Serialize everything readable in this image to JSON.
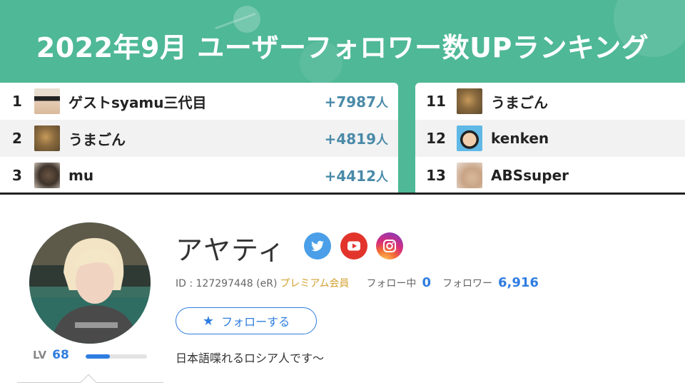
{
  "banner": {
    "title": "2022年9月 ユーザーフォロワー数UPランキング",
    "accent": "#4fb896"
  },
  "ranking": {
    "left": [
      {
        "rank": "1",
        "name": "ゲストsyamu三代目",
        "delta": "+7987",
        "unit": "人"
      },
      {
        "rank": "2",
        "name": "うまごん",
        "delta": "+4819",
        "unit": "人"
      },
      {
        "rank": "3",
        "name": "mu",
        "delta": "+4412",
        "unit": "人"
      }
    ],
    "right": [
      {
        "rank": "11",
        "name": "うまごん"
      },
      {
        "rank": "12",
        "name": "kenken"
      },
      {
        "rank": "13",
        "name": "ABSsuper"
      }
    ]
  },
  "profile": {
    "name": "アヤティ",
    "id_text": "ID : 127297448 (eR)",
    "premium": "プレミアム会員",
    "following_label": "フォロー中",
    "following_count": "0",
    "followers_label": "フォロワー",
    "followers_count": "6,916",
    "follow_button": "フォローする",
    "bio": "日本語喋れるロシア人です～",
    "level_label": "LV",
    "level": "68",
    "level_progress_fraction": 0.4,
    "social_icons": [
      "twitter-icon",
      "youtube-icon",
      "instagram-icon"
    ],
    "accent": "#2f7de1"
  }
}
